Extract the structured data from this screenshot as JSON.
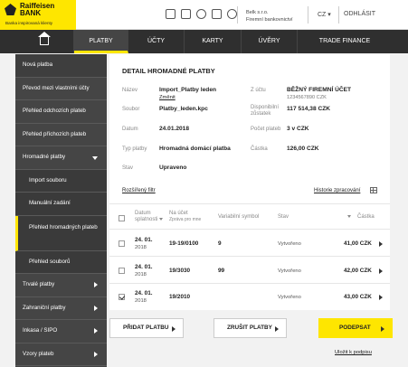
{
  "brand": {
    "name_line1": "Raiffeisen",
    "name_line2": "BANK",
    "tagline": "Banka inspirovaná klienty"
  },
  "header": {
    "company_line1": "Belk s.r.o.",
    "company_line2": "Firemní bankovnictví",
    "language": "CZ",
    "logout": "ODHLÁSIT"
  },
  "nav": {
    "items": [
      "PLATBY",
      "ÚČTY",
      "KARTY",
      "ÚVĚRY",
      "TRADE FINANCE"
    ]
  },
  "sidebar": {
    "items": [
      "Nová platba",
      "Převod mezi vlastními účty",
      "Přehled odchozích plateb",
      "Přehled příchozích plateb",
      "Hromadné platby"
    ],
    "sub_items": [
      "Import souboru",
      "Manuální zadání",
      "Přehled hromadných plateb",
      "Přehled souborů"
    ],
    "bottom_items": [
      "Trvalé platby",
      "Zahraniční platby",
      "Inkasa / SIPO",
      "Vzory plateb"
    ]
  },
  "detail": {
    "title": "DETAIL HROMADNÉ PLATBY",
    "labels": {
      "name": "Název",
      "file": "Soubor",
      "date": "Datum",
      "type": "Typ platby",
      "state": "Stav",
      "from_account": "Z účtu",
      "balance": "Disponibilní zůstatek",
      "count": "Počet plateb",
      "amount": "Částka"
    },
    "values": {
      "name": "Import_Platby leden",
      "change": "Změnit",
      "file": "Platby_leden.kpc",
      "date": "24.01.2018",
      "type": "Hromadná domácí platba",
      "state": "Upraveno",
      "from_account": "BĚŽNÝ FIREMNÍ ÚČET",
      "account_number": "1234567890 CZK",
      "balance": "117 514,38 CZK",
      "count": "3 v CZK",
      "amount": "126,00 CZK"
    },
    "filter_link": "Rozšířený filtr",
    "history_link": "Historie zpracování"
  },
  "table": {
    "headers": {
      "due_date_1": "Datum",
      "due_date_2": "splatnosti",
      "account_1": "Na účet",
      "account_2": "Zpráva pro mne",
      "vs": "Variabilní symbol",
      "state": "Stav",
      "amount": "Částka"
    },
    "rows": [
      {
        "day": "24. 01.",
        "year": "2018",
        "account": "19-19/0100",
        "vs": "9",
        "state": "Vytvořeno",
        "amount": "41,00 CZK",
        "checked": false
      },
      {
        "day": "24. 01.",
        "year": "2018",
        "account": "19/3030",
        "vs": "99",
        "state": "Vytvořeno",
        "amount": "42,00 CZK",
        "checked": false
      },
      {
        "day": "24. 01.",
        "year": "2018",
        "account": "19/2010",
        "vs": "",
        "state": "Vytvořeno",
        "amount": "43,00 CZK",
        "checked": true
      }
    ]
  },
  "buttons": {
    "add": "PŘIDAT PLATBU",
    "cancel": "ZRUŠIT PLATBY",
    "sign": "PODEPSAT",
    "save_for_sign": "Uložit k podpisu"
  },
  "colors": {
    "brand_yellow": "#fee600",
    "nav_dark": "#2f2f2f",
    "sidebar": "#454545"
  }
}
